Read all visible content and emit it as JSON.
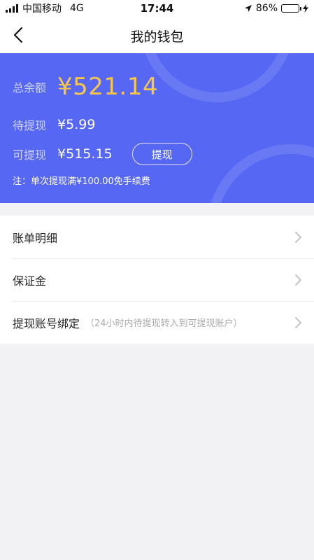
{
  "status_bar": {
    "carrier": "中国移动",
    "network": "4G",
    "time": "17:44",
    "battery_percent": "86%",
    "battery_level": 0.86
  },
  "nav": {
    "title": "我的钱包"
  },
  "wallet": {
    "total_label": "总余额",
    "total_amount": "¥521.14",
    "pending_label": "待提现",
    "pending_amount": "¥5.99",
    "available_label": "可提现",
    "available_amount": "¥515.15",
    "withdraw_button": "提现",
    "note": "注：单次提现满¥100.00免手续费",
    "card_color": "#5567f3",
    "amount_color": "#f8c74a"
  },
  "menu": {
    "items": [
      {
        "label": "账单明细",
        "hint": ""
      },
      {
        "label": "保证金",
        "hint": ""
      },
      {
        "label": "提现账号绑定",
        "hint": "（24小时内待提现转入到可提现账户）"
      }
    ]
  },
  "icons": {
    "back": "chevron-left-icon",
    "item_arrow": "chevron-right-icon",
    "location": "location-arrow-icon",
    "charging": "bolt-icon"
  }
}
